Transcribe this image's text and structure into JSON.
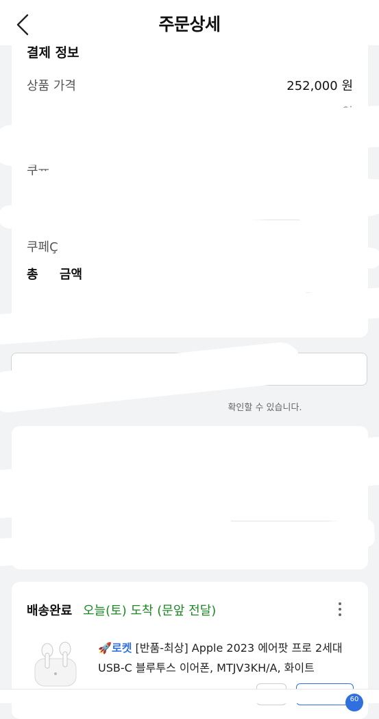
{
  "header": {
    "title": "주문상세"
  },
  "payment": {
    "section_title": "결제 정보",
    "product_price_label": "상품 가격",
    "product_price_value": "252,000 원",
    "coupon_label_1": "쿠ᅲ",
    "coupon_label_2": "쿠페Ç",
    "total_label": "총",
    "total_suffix": "금액",
    "partial_value": "원"
  },
  "notice": {
    "text": "확인할 수 있습니다."
  },
  "shipment": {
    "status": "배송완료",
    "arrival": "오늘(토) 도착 (문앞 전달)",
    "rocket_label": "로켓",
    "product_title": "[반품-최상] Apple 2023 에어팟 프로 2세대 USB-C 블루투스 이어폰, MTJV3KH/A, 화이트"
  },
  "chat": {
    "badge": "60"
  },
  "colors": {
    "accent": "#2f6fe0",
    "success": "#1a8a22"
  },
  "icons": [
    "back-icon",
    "kebab-icon",
    "rocket-icon"
  ]
}
